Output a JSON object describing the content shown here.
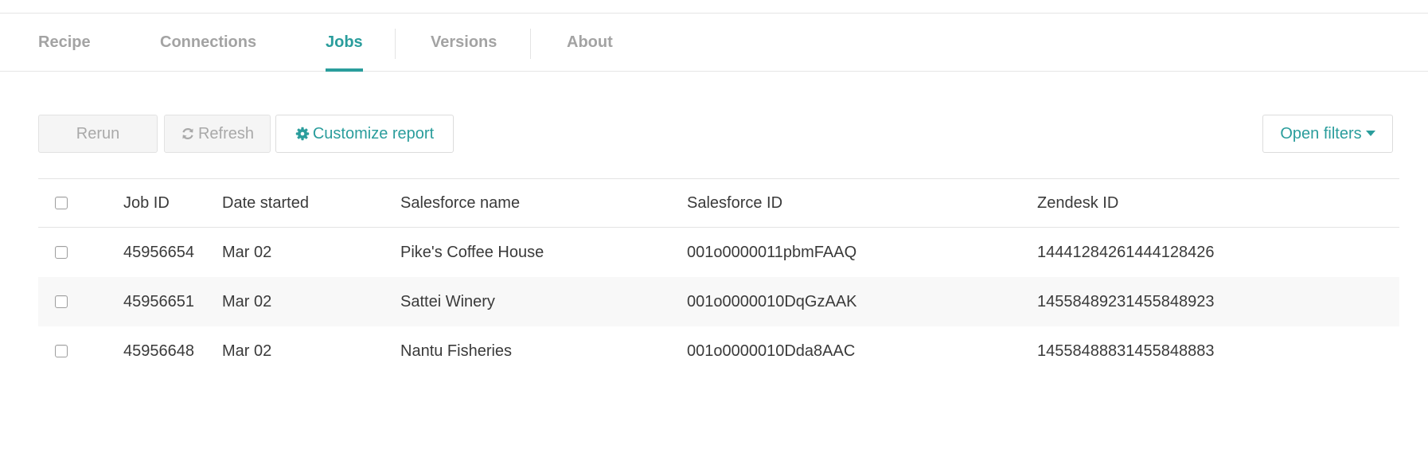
{
  "tabs": [
    {
      "label": "Recipe",
      "active": false
    },
    {
      "label": "Connections",
      "active": false
    },
    {
      "label": "Jobs",
      "active": true
    },
    {
      "label": "Versions",
      "active": false
    },
    {
      "label": "About",
      "active": false
    }
  ],
  "toolbar": {
    "rerun_label": "Rerun",
    "refresh_label": "Refresh",
    "customize_label": "Customize report",
    "filters_label": "Open filters",
    "accent_color": "#2a9d9c"
  },
  "table": {
    "columns": [
      "Job ID",
      "Date started",
      "Salesforce name",
      "Salesforce ID",
      "Zendesk ID"
    ],
    "rows": [
      {
        "job_id": "45956654",
        "date": "Mar 02",
        "sf_name": "Pike's Coffee House",
        "sf_id": "001o0000011pbmFAAQ",
        "zd_id": "14441284261444128426"
      },
      {
        "job_id": "45956651",
        "date": "Mar 02",
        "sf_name": "Sattei Winery",
        "sf_id": "001o0000010DqGzAAK",
        "zd_id": "14558489231455848923"
      },
      {
        "job_id": "45956648",
        "date": "Mar 02",
        "sf_name": "Nantu Fisheries",
        "sf_id": "001o0000010Dda8AAC",
        "zd_id": "14558488831455848883"
      }
    ]
  }
}
